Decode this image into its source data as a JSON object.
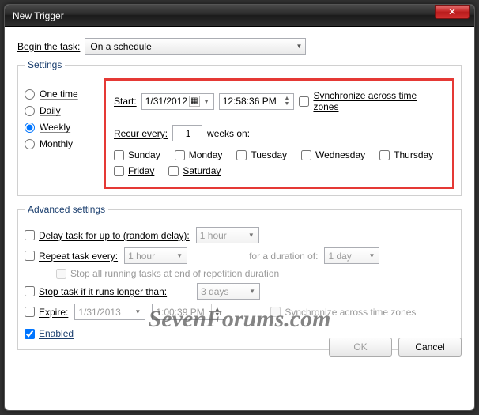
{
  "window": {
    "title": "New Trigger"
  },
  "begin": {
    "label": "Begin the task:",
    "value": "On a schedule"
  },
  "settings": {
    "legend": "Settings",
    "radios": {
      "one_time": "One time",
      "daily": "Daily",
      "weekly": "Weekly",
      "monthly": "Monthly",
      "selected": "weekly"
    },
    "start_label": "Start:",
    "start_date": "1/31/2012",
    "start_time": "12:58:36 PM",
    "sync_label": "Synchronize across time zones",
    "recur_label_pre": "Recur every:",
    "recur_value": "1",
    "recur_label_post": "weeks on:",
    "days": {
      "sun": "Sunday",
      "mon": "Monday",
      "tue": "Tuesday",
      "wed": "Wednesday",
      "thu": "Thursday",
      "fri": "Friday",
      "sat": "Saturday"
    }
  },
  "advanced": {
    "legend": "Advanced settings",
    "delay_label": "Delay task for up to (random delay):",
    "delay_value": "1 hour",
    "repeat_label": "Repeat task every:",
    "repeat_value": "1 hour",
    "duration_label": "for a duration of:",
    "duration_value": "1 day",
    "stop_all_label": "Stop all running tasks at end of repetition duration",
    "stop_if_label": "Stop task if it runs longer than:",
    "stop_if_value": "3 days",
    "expire_label": "Expire:",
    "expire_date": "1/31/2013",
    "expire_time": "1:00:39 PM",
    "expire_sync": "Synchronize across time zones",
    "enabled_label": "Enabled"
  },
  "buttons": {
    "ok": "OK",
    "cancel": "Cancel"
  },
  "watermark": "SevenForums.com"
}
